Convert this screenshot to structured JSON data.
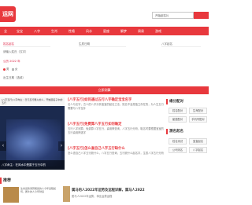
{
  "header": {
    "logo_text": "运网",
    "search_value": "开始起名片"
  },
  "nav": {
    "items": [
      "全",
      "宝宝",
      "八字",
      "生肖",
      "性格",
      "风水",
      "星座",
      "解梦",
      "周易",
      "游戏"
    ]
  },
  "form": {
    "surname_placeholder": "姓名起名",
    "surname_hint": "请输入姓氏（汉字）",
    "given_placeholder": "生辰日期",
    "given_hint": "八字起名",
    "birth_value": "公历 2022 年",
    "gender_male": "男",
    "gender_female": "女",
    "extra_label": "出生日期（选填）",
    "submit_label": "立即测算"
  },
  "slider": {
    "top_caption": "[八字五行]八字命主：日元五行属火的人，开始起名子中的五行",
    "caption": "八字命主：在风水中是属于五行中的",
    "prev": "‹",
    "next": "›"
  },
  "articles": [
    {
      "title": "[八字五行]如何通过五行八字确定宝宝名字",
      "text": "名人与名字，古人的八字分析宝宝的起名之法，姓名不会是独立存在的，为人生五行需要与八字互补"
    },
    {
      "title": "[八字五行]免费算八字五行如何确定",
      "text": "五行八字测算，免费算八字五行，喜用神查询，八字五行分析，取名时要根据宝宝的五行喜用神选字"
    },
    {
      "title": "[八字五行]怎么查自己八字五行缺什么",
      "text": "怎么查自己八字五行缺什么，八字五行查询，五行缺什么起名字，生辰八字五行分析"
    }
  ],
  "sidebar": {
    "title1": "缘分配对",
    "buttons1": [
      "姓名配对",
      "生肖配对",
      "星座配对",
      "手机号配对"
    ],
    "title2": "测名起名",
    "buttons2": [
      "姓名测试",
      "宝宝起名",
      "公司测名",
      "八字起名"
    ]
  },
  "recommend": {
    "title": "推荐",
    "thumb_text": "生肖运势测算属鼠的人今年运程如何，属牛的人今年财运",
    "item_title": "属马的人2022年运势及运程详解，属马人2022",
    "item_desc": "属马人2022年运势，事业运势运程"
  }
}
